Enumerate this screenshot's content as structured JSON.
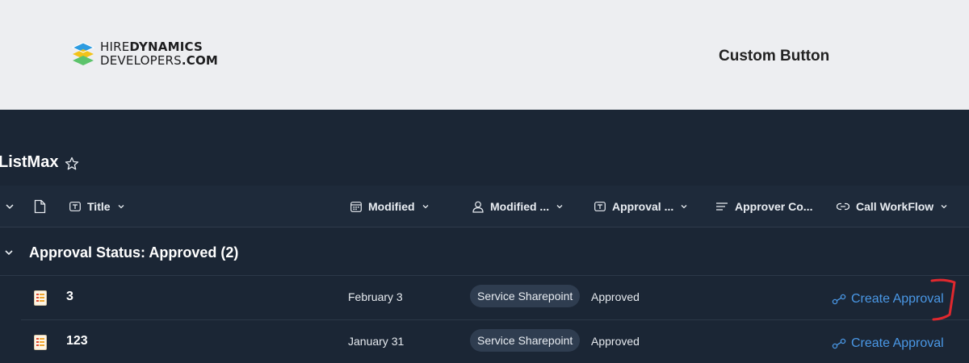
{
  "banner": {
    "logo_line1_light": "HIRE",
    "logo_line1_bold": "DYNAMICS",
    "logo_line2_light": "DEVELOPERS",
    "logo_line2_bold": ".COM",
    "title": "Custom Button"
  },
  "list": {
    "title": "ListMax"
  },
  "columns": {
    "title": "Title",
    "modified": "Modified",
    "modified_by": "Modified ...",
    "approval": "Approval ...",
    "approver_comments": "Approver Co...",
    "call_workflow": "Call WorkFlow"
  },
  "group": {
    "label": "Approval Status: Approved (2)"
  },
  "rows": [
    {
      "title": "3",
      "modified": "February 3",
      "modified_by": "Service Sharepoint",
      "approval": "Approved",
      "workflow_link": "Create Approval"
    },
    {
      "title": "123",
      "modified": "January 31",
      "modified_by": "Service Sharepoint",
      "approval": "Approved",
      "workflow_link": "Create Approval"
    }
  ],
  "colors": {
    "banner_bg": "#edeef1",
    "app_bg": "#1b2635",
    "link": "#4a98e6",
    "annotation": "#e0282e"
  }
}
